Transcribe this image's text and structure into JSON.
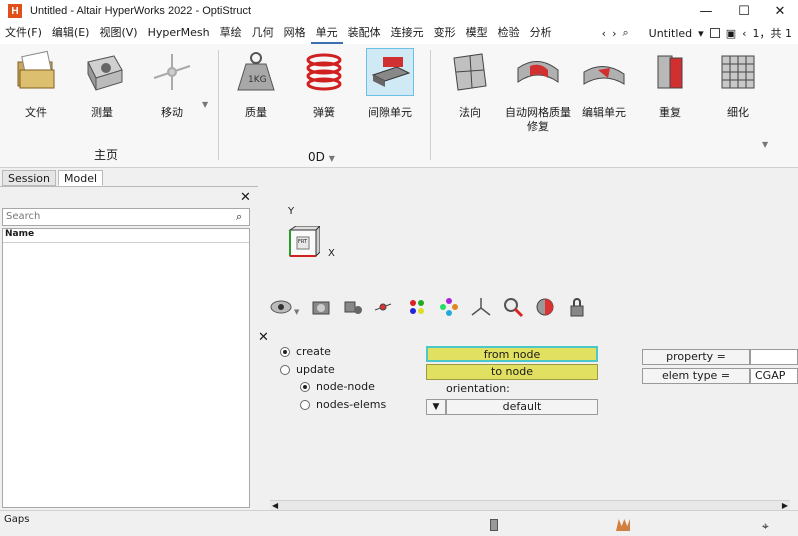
{
  "window": {
    "title": "Untitled - Altair HyperWorks 2022 - OptiStruct",
    "app_letter": "H"
  },
  "menu": {
    "items": [
      "文件(F)",
      "编辑(E)",
      "视图(V)",
      "HyperMesh",
      "草绘",
      "几何",
      "网格",
      "单元",
      "装配体",
      "连接元",
      "变形",
      "模型",
      "检验",
      "分析"
    ],
    "active": "单元",
    "doc_name": "Untitled",
    "page_info": "1，共 1"
  },
  "ribbon": {
    "buttons": [
      {
        "label": "文件",
        "icon": "folder-file-icon"
      },
      {
        "label": "测量",
        "icon": "measure-icon"
      },
      {
        "label": "移动",
        "icon": "move-icon"
      },
      {
        "label": "质量",
        "icon": "mass-weight-icon"
      },
      {
        "label": "弹簧",
        "icon": "spring-icon"
      },
      {
        "label": "间隙单元",
        "icon": "gap-element-icon"
      },
      {
        "label": "法向",
        "icon": "normal-icon"
      },
      {
        "label": "自动网格质量修复",
        "icon": "auto-mesh-icon"
      },
      {
        "label": "编辑单元",
        "icon": "edit-element-icon"
      },
      {
        "label": "重复",
        "icon": "duplicate-icon"
      },
      {
        "label": "细化",
        "icon": "refine-icon"
      }
    ],
    "group_main": "主页",
    "group_0d": "0D"
  },
  "left_panel": {
    "tabs": [
      "Session",
      "Model"
    ],
    "active_tab": "Model",
    "search_placeholder": "Search",
    "column_name": "Name"
  },
  "graphics": {
    "axis_y": "Y",
    "axis_x": "X",
    "cube_label": "FRT"
  },
  "gap_panel": {
    "create": "create",
    "update": "update",
    "node_node": "node-node",
    "nodes_elems": "nodes-elems",
    "from_node": "from node",
    "to_node": "to node",
    "orientation": "orientation:",
    "default": "default",
    "property": "property =",
    "property_value": "",
    "elem_type": "elem type =",
    "elem_type_value": "CGAP"
  },
  "status": {
    "text": "Gaps"
  }
}
